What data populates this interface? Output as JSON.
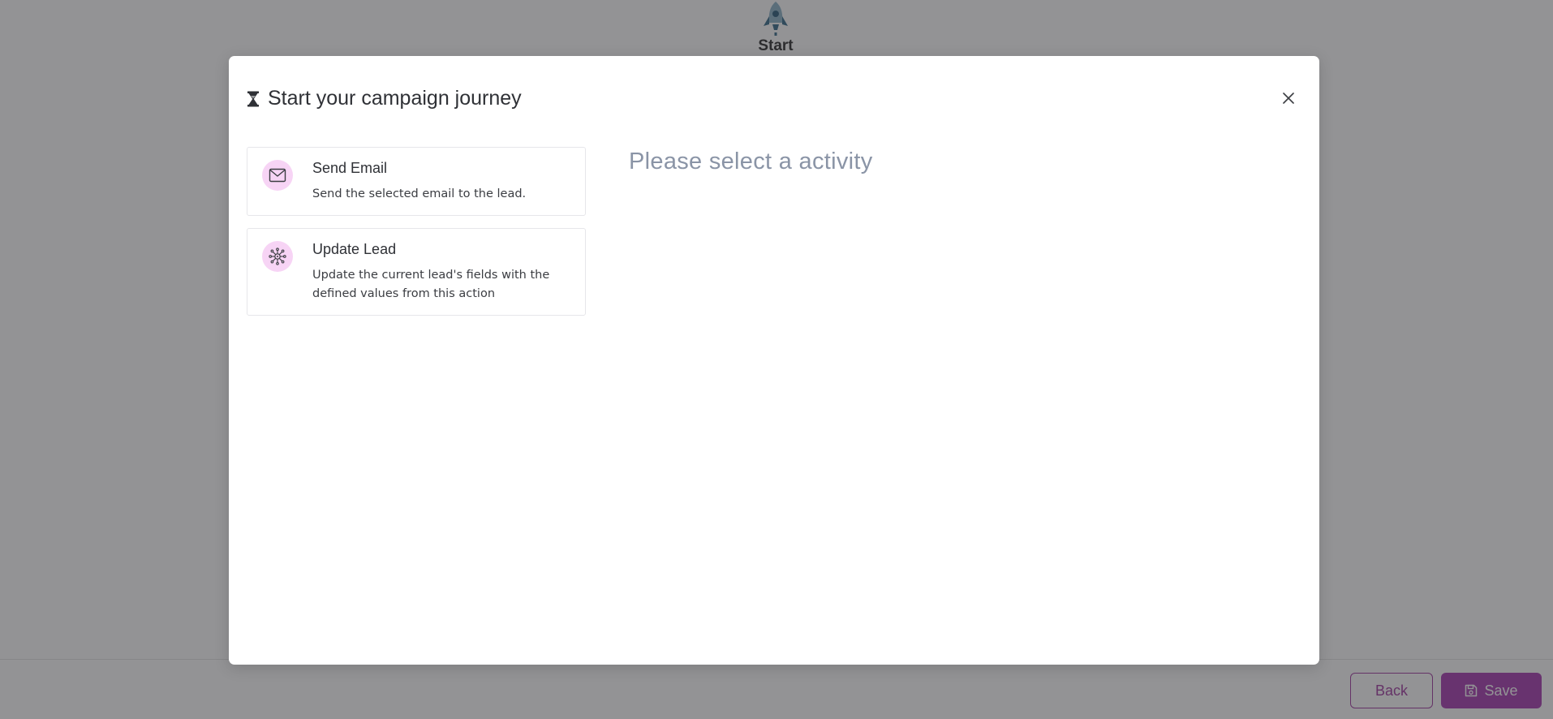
{
  "canvas": {
    "start_node_label": "Start",
    "start_node_icon": "rocket-icon"
  },
  "footer": {
    "back_label": "Back",
    "save_label": "Save",
    "save_icon": "floppy-disk-icon"
  },
  "modal": {
    "title": "Start your campaign journey",
    "title_icon": "hourglass-icon",
    "close_icon": "close-icon",
    "activities": [
      {
        "title": "Send Email",
        "description": "Send the selected email to the lead.",
        "icon": "envelope-icon"
      },
      {
        "title": "Update Lead",
        "description": "Update the current lead's fields with the defined values from this action",
        "icon": "network-node-icon"
      }
    ],
    "placeholder": "Please select a activity"
  },
  "colors": {
    "accent": "#a83fb2",
    "icon_bg": "#f7d4f5",
    "placeholder": "#8a94a6",
    "overlay": "rgba(40,40,44,0.5)"
  }
}
